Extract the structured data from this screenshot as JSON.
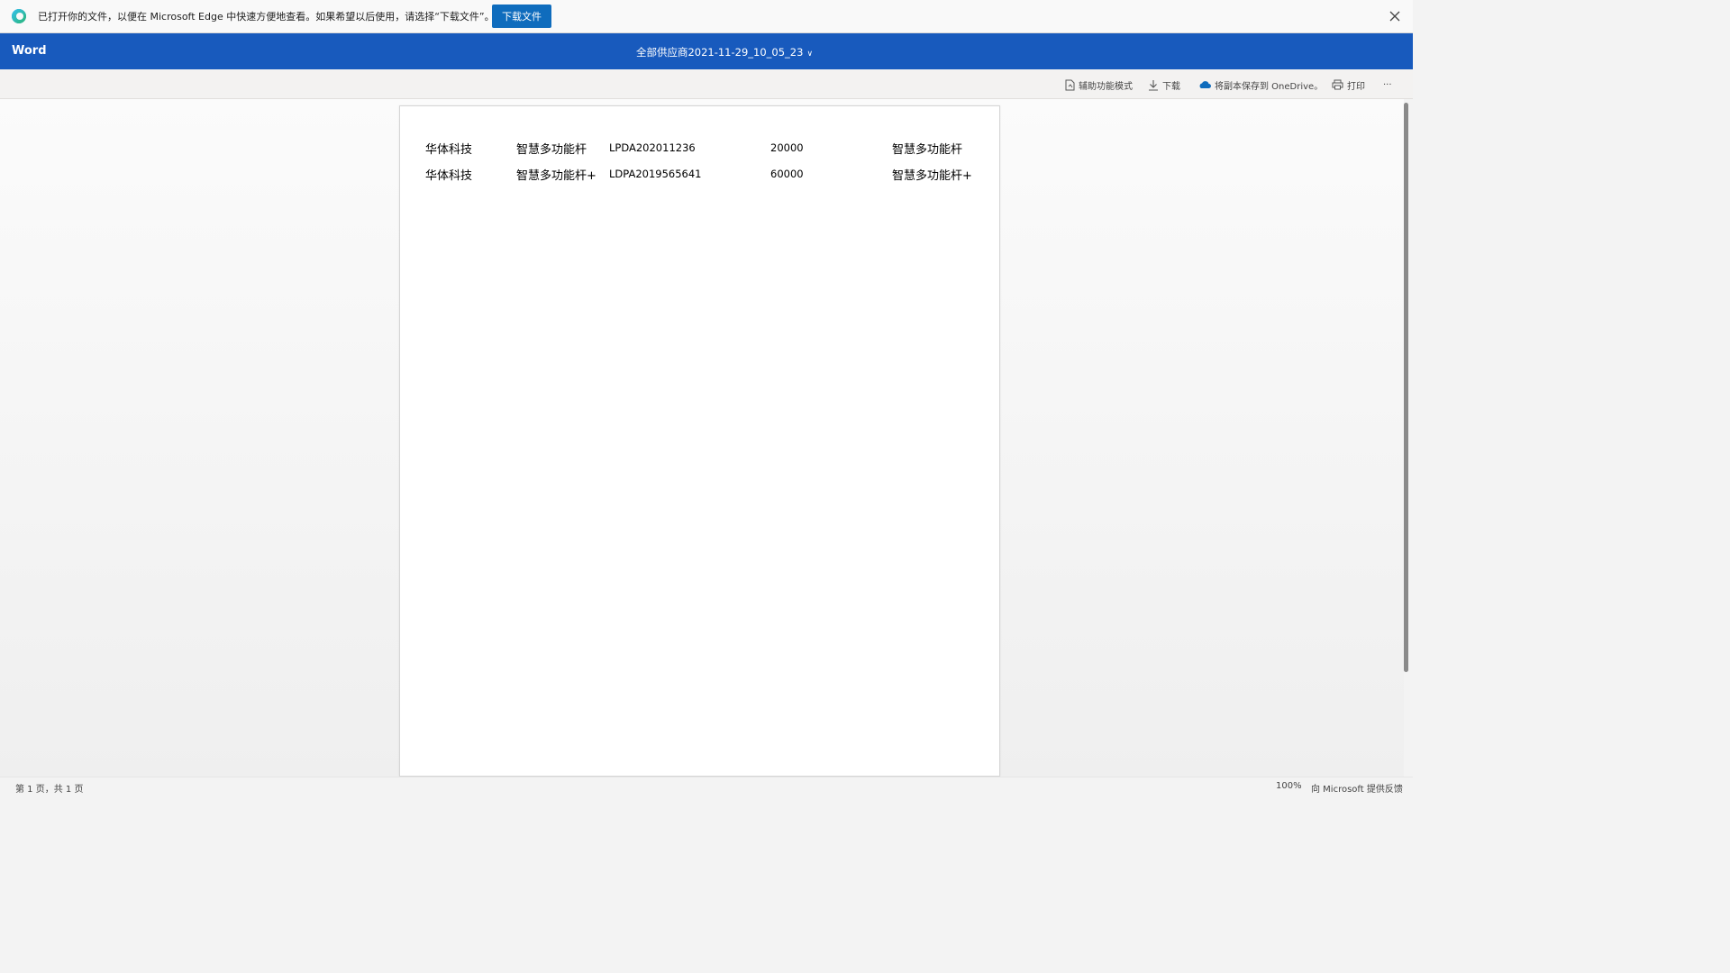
{
  "infobar": {
    "message": "已打开你的文件，以便在 Microsoft Edge 中快速方便地查看。如果希望以后使用，请选择“下载文件”。",
    "download_button": "下载文件"
  },
  "header": {
    "app_name": "Word",
    "document_title": "全部供应商2021-11-29_10_05_23"
  },
  "commands": {
    "accessibility": "辅助功能模式",
    "download": "下载",
    "save_onedrive": "将副本保存到 OneDrive。",
    "print": "打印",
    "more": "···"
  },
  "document": {
    "rows": [
      [
        "华体科技",
        "智慧多功能杆",
        "LPDA202011236",
        "20000",
        "智慧多功能杆"
      ],
      [
        "华体科技",
        "智慧多功能杆+",
        "LDPA2019565641",
        "60000",
        "智慧多功能杆+"
      ]
    ]
  },
  "status": {
    "page_count": "第 1 页，共 1 页",
    "zoom": "100%",
    "feedback": "向 Microsoft 提供反馈"
  },
  "colors": {
    "header_bg": "#185abd",
    "accent_button": "#0f6cbd"
  }
}
